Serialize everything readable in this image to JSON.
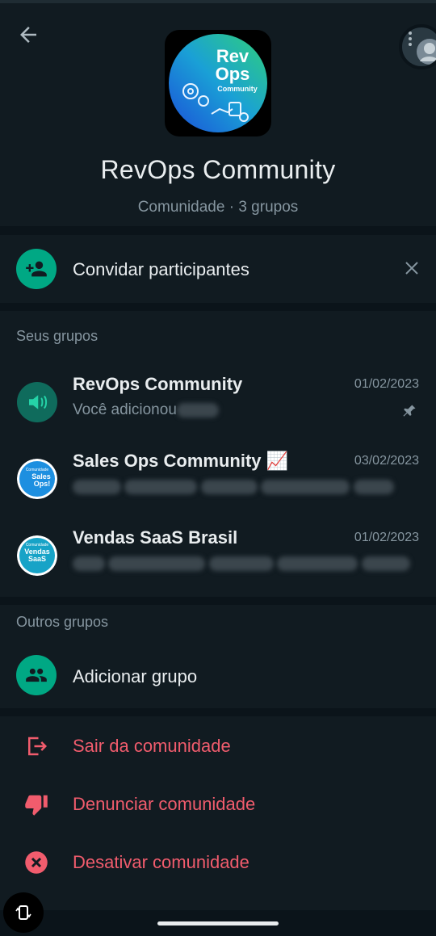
{
  "header": {
    "title": "RevOps Community",
    "subtitle": "Comunidade · 3 grupos",
    "logo_text_line1": "Rev",
    "logo_text_line2": "Ops",
    "logo_text_line3": "Community"
  },
  "invite": {
    "label": "Convidar participantes"
  },
  "your_groups": {
    "title": "Seus grupos",
    "items": [
      {
        "name": "RevOps Community",
        "date": "01/02/2023",
        "message": "Você adicionou",
        "pinned": true
      },
      {
        "name": "Sales Ops Community 📈",
        "date": "03/02/2023",
        "message": "",
        "avatar_text1": "Comunidade",
        "avatar_text2": "Sales",
        "avatar_text3": "Ops!"
      },
      {
        "name": "Vendas SaaS Brasil",
        "date": "01/02/2023",
        "message": "",
        "avatar_text1": "Comunidade",
        "avatar_text2": "Vendas",
        "avatar_text3": "SaaS"
      }
    ]
  },
  "other_groups": {
    "title": "Outros grupos",
    "add_label": "Adicionar grupo"
  },
  "actions": {
    "leave": "Sair da comunidade",
    "report": "Denunciar comunidade",
    "deactivate": "Desativar comunidade"
  },
  "colors": {
    "accent": "#00a884",
    "danger": "#f15c6d",
    "background": "#111b21"
  }
}
